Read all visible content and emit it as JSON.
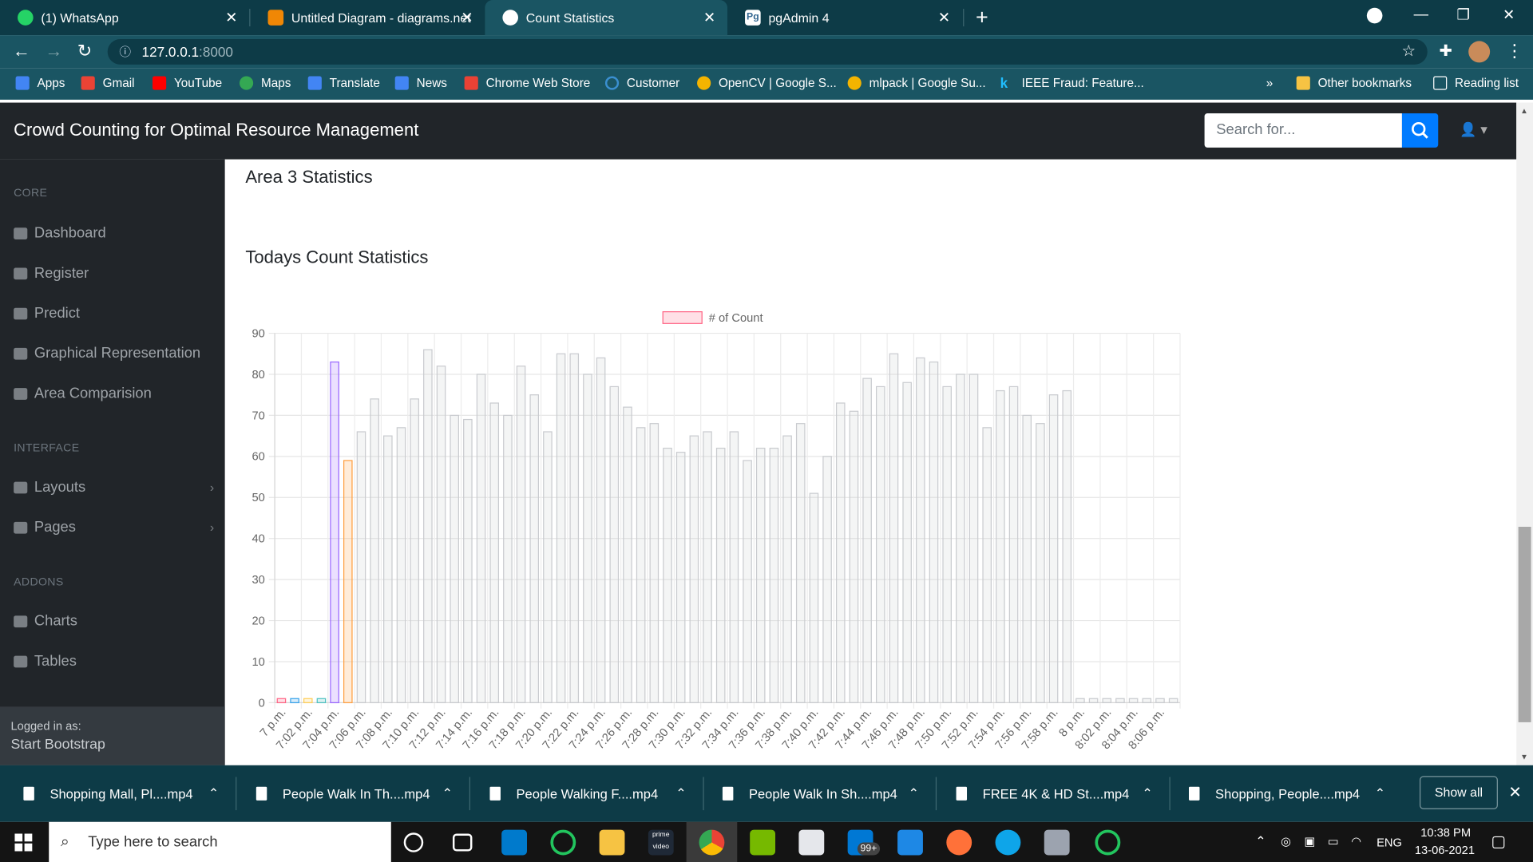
{
  "browser": {
    "tabs": [
      {
        "title": "(1) WhatsApp",
        "icon": "whatsapp-icon"
      },
      {
        "title": "Untitled Diagram - diagrams.net",
        "icon": "drawio-icon"
      },
      {
        "title": "Count Statistics",
        "icon": "globe-icon",
        "active": true
      },
      {
        "title": "pgAdmin 4",
        "icon": "pgadmin-icon"
      }
    ],
    "url_host": "127.0.0.1",
    "url_port": ":8000",
    "bookmarks": [
      "Apps",
      "Gmail",
      "YouTube",
      "Maps",
      "Translate",
      "News",
      "Chrome Web Store",
      "Customer",
      "OpenCV | Google S...",
      "mlpack | Google Su...",
      "IEEE Fraud: Feature..."
    ],
    "bookmarks_overflow": "»",
    "other_bookmarks": "Other bookmarks",
    "reading_list": "Reading list"
  },
  "app": {
    "brand": "Crowd Counting for Optimal Resource Management",
    "search_placeholder": "Search for..."
  },
  "sidebar": {
    "sections": [
      {
        "heading": "CORE",
        "items": [
          "Dashboard",
          "Register",
          "Predict",
          "Graphical Representation",
          "Area Comparision"
        ]
      },
      {
        "heading": "INTERFACE",
        "items": [
          "Layouts",
          "Pages"
        ]
      },
      {
        "heading": "ADDONS",
        "items": [
          "Charts",
          "Tables"
        ]
      }
    ],
    "footer_label": "Logged in as:",
    "footer_user": "Start Bootstrap"
  },
  "main": {
    "area_title": "Area 3 Statistics",
    "chart_title": "Todays Count Statistics"
  },
  "chart_data": {
    "type": "bar",
    "legend": "# of Count",
    "ylim": [
      0,
      90
    ],
    "yticks": [
      0,
      10,
      20,
      30,
      40,
      50,
      60,
      70,
      80,
      90
    ],
    "categories": [
      "7 p.m.",
      "7:01 p.m.",
      "7:02 p.m.",
      "7:03 p.m.",
      "7:04 p.m.",
      "7:05 p.m.",
      "7:06 p.m.",
      "7:07 p.m.",
      "7:08 p.m.",
      "7:09 p.m.",
      "7:10 p.m.",
      "7:11 p.m.",
      "7:12 p.m.",
      "7:13 p.m.",
      "7:14 p.m.",
      "7:15 p.m.",
      "7:16 p.m.",
      "7:17 p.m.",
      "7:18 p.m.",
      "7:19 p.m.",
      "7:20 p.m.",
      "7:21 p.m.",
      "7:22 p.m.",
      "7:23 p.m.",
      "7:24 p.m.",
      "7:25 p.m.",
      "7:26 p.m.",
      "7:27 p.m.",
      "7:28 p.m.",
      "7:29 p.m.",
      "7:30 p.m.",
      "7:31 p.m.",
      "7:32 p.m.",
      "7:33 p.m.",
      "7:34 p.m.",
      "7:35 p.m.",
      "7:36 p.m.",
      "7:37 p.m.",
      "7:38 p.m.",
      "7:39 p.m.",
      "7:40 p.m.",
      "7:41 p.m.",
      "7:42 p.m.",
      "7:43 p.m.",
      "7:44 p.m.",
      "7:45 p.m.",
      "7:46 p.m.",
      "7:47 p.m.",
      "7:48 p.m.",
      "7:49 p.m.",
      "7:50 p.m.",
      "7:51 p.m.",
      "7:52 p.m.",
      "7:53 p.m.",
      "7:54 p.m.",
      "7:55 p.m.",
      "7:56 p.m.",
      "7:57 p.m.",
      "7:58 p.m.",
      "7:59 p.m.",
      "8 p.m.",
      "8:01 p.m.",
      "8:02 p.m.",
      "8:03 p.m.",
      "8:04 p.m.",
      "8:05 p.m.",
      "8:06 p.m.",
      "8:07 p.m."
    ],
    "xtick_labels": [
      "7 p.m.",
      "7:02 p.m.",
      "7:04 p.m.",
      "7:06 p.m.",
      "7:08 p.m.",
      "7:10 p.m.",
      "7:12 p.m.",
      "7:14 p.m.",
      "7:16 p.m.",
      "7:18 p.m.",
      "7:20 p.m.",
      "7:22 p.m.",
      "7:24 p.m.",
      "7:26 p.m.",
      "7:28 p.m.",
      "7:30 p.m.",
      "7:32 p.m.",
      "7:34 p.m.",
      "7:36 p.m.",
      "7:38 p.m.",
      "7:40 p.m.",
      "7:42 p.m.",
      "7:44 p.m.",
      "7:46 p.m.",
      "7:48 p.m.",
      "7:50 p.m.",
      "7:52 p.m.",
      "7:54 p.m.",
      "7:56 p.m.",
      "7:58 p.m.",
      "8 p.m.",
      "8:02 p.m.",
      "8:04 p.m.",
      "8:06 p.m."
    ],
    "values": [
      1,
      1,
      1,
      1,
      83,
      59,
      66,
      74,
      65,
      67,
      74,
      86,
      82,
      70,
      69,
      80,
      73,
      70,
      82,
      75,
      66,
      85,
      85,
      80,
      84,
      77,
      72,
      67,
      68,
      62,
      61,
      65,
      66,
      62,
      66,
      59,
      62,
      62,
      65,
      68,
      51,
      60,
      73,
      71,
      79,
      77,
      85,
      78,
      84,
      83,
      77,
      80,
      80,
      67,
      76,
      77,
      70,
      68,
      75,
      76,
      1,
      1,
      1,
      1,
      1,
      1,
      1,
      1
    ],
    "bar_colors": {
      "pink": "#ff6384",
      "blue": "#36a2eb",
      "yellow": "#ffce56",
      "teal": "#4bc0c0",
      "purple": "#9966ff",
      "orange": "#ff9f40",
      "grey": "#c9cbcf"
    },
    "color_sequence": [
      "pink",
      "blue",
      "yellow",
      "teal",
      "purple",
      "orange"
    ]
  },
  "downloads": {
    "items": [
      "Shopping Mall, Pl....mp4",
      "People Walk In Th....mp4",
      "People Walking F....mp4",
      "People Walk In Sh....mp4",
      "FREE 4K & HD St....mp4",
      "Shopping, People....mp4"
    ],
    "show_all": "Show all"
  },
  "taskbar": {
    "search_placeholder": "Type here to search",
    "badge": "99+",
    "lang": "ENG",
    "time": "10:38 PM",
    "date": "13-06-2021"
  }
}
